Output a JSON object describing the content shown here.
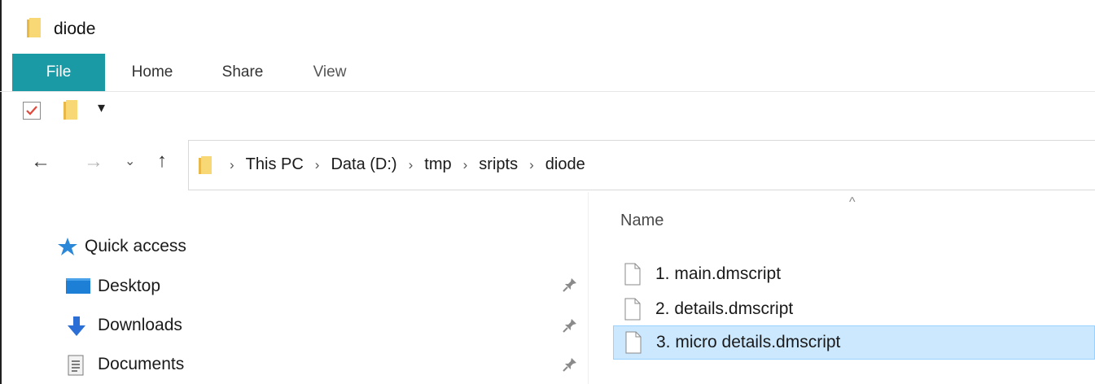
{
  "window": {
    "title": "diode"
  },
  "ribbon": {
    "tabs": [
      {
        "label": "File",
        "active": true
      },
      {
        "label": "Home"
      },
      {
        "label": "Share"
      },
      {
        "label": "View"
      }
    ],
    "accent_color": "#1a9aa5"
  },
  "quick_access_toolbar": {
    "items": [
      "properties-check-icon",
      "new-folder-icon",
      "customize-dropdown-icon"
    ],
    "dropdown_glyph": "▾"
  },
  "navigation": {
    "back_glyph": "←",
    "forward_glyph": "→",
    "recent_glyph": "⌄",
    "up_glyph": "↑",
    "breadcrumb": [
      "This PC",
      "Data (D:)",
      "tmp",
      "sripts",
      "diode"
    ],
    "separator": "›"
  },
  "nav_pane": {
    "items": [
      {
        "label": "Quick access",
        "icon": "star-icon",
        "pinned": false
      },
      {
        "label": "Desktop",
        "icon": "desktop-icon",
        "pinned": true
      },
      {
        "label": "Downloads",
        "icon": "download-arrow-icon",
        "pinned": true
      },
      {
        "label": "Documents",
        "icon": "documents-icon",
        "pinned": true
      }
    ],
    "pin_glyph": "📌"
  },
  "file_list": {
    "sort_indicator": "^",
    "column_name": "Name",
    "files": [
      {
        "name": "1. main.dmscript",
        "selected": false
      },
      {
        "name": "2. details.dmscript",
        "selected": false
      },
      {
        "name": "3. micro details.dmscript",
        "selected": true
      }
    ],
    "selection_color": "#cce8ff"
  }
}
